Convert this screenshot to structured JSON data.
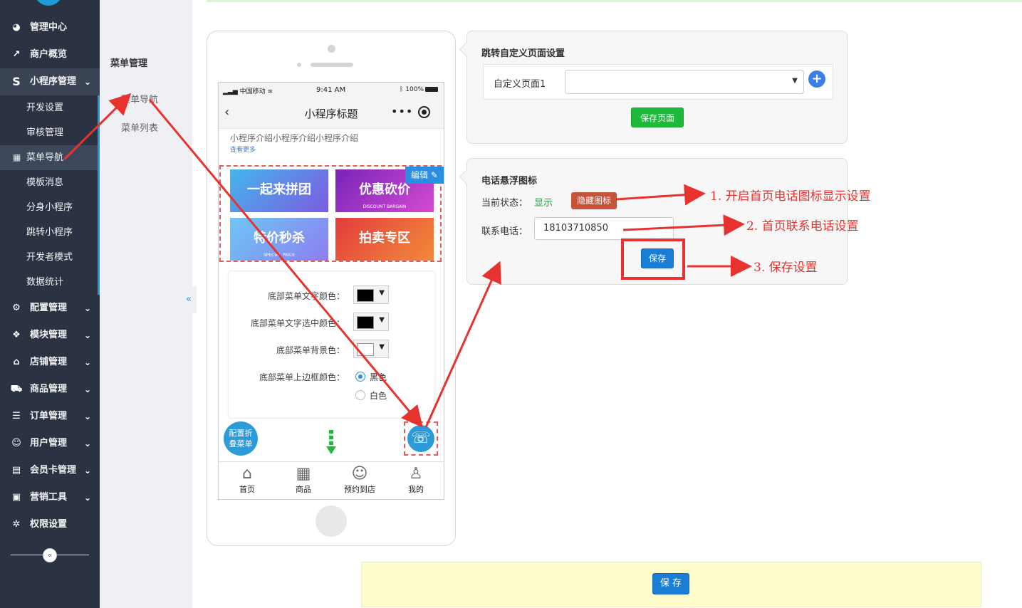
{
  "sidebar": {
    "items": [
      {
        "label": "管理中心",
        "icon": "dashboard-icon"
      },
      {
        "label": "商户概览",
        "icon": "line-chart-icon"
      },
      {
        "label": "小程序管理",
        "icon": "s-logo-icon",
        "open": true
      },
      {
        "label": "配置管理",
        "icon": "gears-icon"
      },
      {
        "label": "模块管理",
        "icon": "cubes-icon"
      },
      {
        "label": "店铺管理",
        "icon": "bank-icon"
      },
      {
        "label": "商品管理",
        "icon": "cart-icon"
      },
      {
        "label": "订单管理",
        "icon": "list-icon"
      },
      {
        "label": "用户管理",
        "icon": "user-icon"
      },
      {
        "label": "会员卡管理",
        "icon": "card-icon"
      },
      {
        "label": "营销工具",
        "icon": "briefcase-icon"
      },
      {
        "label": "权限设置",
        "icon": "gear-icon"
      }
    ],
    "sub_items": [
      "开发设置",
      "审核管理",
      "菜单导航",
      "模板消息",
      "分身小程序",
      "跳转小程序",
      "开发者模式",
      "数据统计"
    ],
    "active_sub": "菜单导航"
  },
  "submenu": {
    "title": "菜单管理",
    "links": [
      "菜单导航",
      "菜单列表"
    ]
  },
  "phone": {
    "status_carrier": "中国移动",
    "status_time": "9:41 AM",
    "status_battery": "100%",
    "nav_title": "小程序标题",
    "intro": "小程序介绍小程序介绍小程序介绍",
    "see_more": "查看更多",
    "edit_tag": "编辑",
    "banners": [
      {
        "text": "一起来拼团",
        "sub": ""
      },
      {
        "text": "优惠砍价",
        "sub": "DISCOUNT BARGAIN"
      },
      {
        "text": "特价秒杀",
        "sub": "SPECIAL PRICE"
      },
      {
        "text": "拍卖专区",
        "sub": ""
      }
    ],
    "config": {
      "text_color_label": "底部菜单文字颜色：",
      "text_selected_color_label": "底部菜单文字选中颜色：",
      "bg_color_label": "底部菜单背景色：",
      "border_color_label": "底部菜单上边框颜色：",
      "border_options": [
        "黑色",
        "白色"
      ],
      "text_color": "#000000",
      "text_selected_color": "#000000",
      "bg_color": "#ffffff"
    },
    "fold_menu_label": "配置折叠菜单",
    "tabs": [
      {
        "label": "首页",
        "icon": "home-icon"
      },
      {
        "label": "商品",
        "icon": "grid-icon"
      },
      {
        "label": "预约到店",
        "icon": "smile-icon"
      },
      {
        "label": "我的",
        "icon": "person-icon"
      }
    ]
  },
  "custom_page": {
    "title": "跳转自定义页面设置",
    "page_label": "自定义页面1",
    "select_value": "",
    "save_label": "保存页面"
  },
  "phone_icon": {
    "title": "电话悬浮图标",
    "state_label": "当前状态：",
    "state_value": "显示",
    "hide_label": "隐藏图标",
    "phone_label": "联系电话：",
    "phone_value": "18103710850",
    "save_label": "保存"
  },
  "annotations": [
    "1.  开启首页电话图标显示设置",
    "2.  首页联系电话设置",
    "3.  保存设置"
  ],
  "footer": {
    "save_label": "保 存"
  },
  "colors": {
    "sidebar_bg": "#2b3342",
    "accent_blue": "#1a7fd4",
    "arrow_red": "#e8322f",
    "green": "#1db93a"
  }
}
